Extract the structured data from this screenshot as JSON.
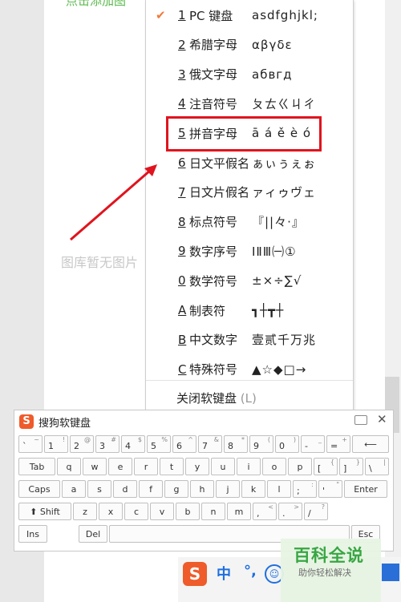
{
  "page": {
    "partial_top_text": "点击添加图",
    "no_image_text": "图库暂无图片"
  },
  "menu": {
    "items": [
      {
        "num": "1",
        "label": "PC 键盘",
        "sample": "asdfghjkl;",
        "checked": true
      },
      {
        "num": "2",
        "label": "希腊字母",
        "sample": "αβγδε",
        "checked": false
      },
      {
        "num": "3",
        "label": "俄文字母",
        "sample": "абвгд",
        "checked": false
      },
      {
        "num": "4",
        "label": "注音符号",
        "sample": "ㄆㄊㄍㄐㄔ",
        "checked": false
      },
      {
        "num": "5",
        "label": "拼音字母",
        "sample": "ā á ě è ó",
        "checked": false
      },
      {
        "num": "6",
        "label": "日文平假名",
        "sample": "ぁぃぅぇぉ",
        "checked": false
      },
      {
        "num": "7",
        "label": "日文片假名",
        "sample": "ァィゥヴェ",
        "checked": false
      },
      {
        "num": "8",
        "label": "标点符号",
        "sample": "『||々·』",
        "checked": false
      },
      {
        "num": "9",
        "label": "数字序号",
        "sample": "ⅠⅡⅢ㈠①",
        "checked": false
      },
      {
        "num": "0",
        "label": "数学符号",
        "sample": "±×÷∑√",
        "checked": false
      },
      {
        "num": "A",
        "label": "制表符",
        "sample": "┓┼┳┼",
        "checked": false
      },
      {
        "num": "B",
        "label": "中文数字",
        "sample": "壹贰千万兆",
        "checked": false
      },
      {
        "num": "C",
        "label": "特殊符号",
        "sample": "▲☆◆□→",
        "checked": false
      }
    ],
    "close_label": "关闭软键盘",
    "close_shortcut": "(L)",
    "check_mark": "✔",
    "highlight_color": "#e0141e",
    "arrow_color": "#e0141e"
  },
  "keyboard": {
    "title": "搜狗软键盘",
    "logo": "S",
    "close_glyph": "✕",
    "rows": [
      [
        {
          "up": "~",
          "dn": "`"
        },
        {
          "up": "!",
          "dn": "1"
        },
        {
          "up": "@",
          "dn": "2"
        },
        {
          "up": "#",
          "dn": "3"
        },
        {
          "up": "$",
          "dn": "4"
        },
        {
          "up": "%",
          "dn": "5"
        },
        {
          "up": "^",
          "dn": "6"
        },
        {
          "up": "&",
          "dn": "7"
        },
        {
          "up": "*",
          "dn": "8"
        },
        {
          "up": "(",
          "dn": "9"
        },
        {
          "up": ")",
          "dn": "0"
        },
        {
          "up": "_",
          "dn": "-"
        },
        {
          "up": "+",
          "dn": "="
        },
        {
          "mid": "⟵"
        }
      ],
      [
        {
          "mid": "Tab"
        },
        {
          "mid": "q"
        },
        {
          "mid": "w"
        },
        {
          "mid": "e"
        },
        {
          "mid": "r"
        },
        {
          "mid": "t"
        },
        {
          "mid": "y"
        },
        {
          "mid": "u"
        },
        {
          "mid": "i"
        },
        {
          "mid": "o"
        },
        {
          "mid": "p"
        },
        {
          "up": "{",
          "dn": "["
        },
        {
          "up": "}",
          "dn": "]"
        },
        {
          "up": "|",
          "dn": "\\"
        }
      ],
      [
        {
          "mid": "Caps"
        },
        {
          "mid": "a"
        },
        {
          "mid": "s"
        },
        {
          "mid": "d"
        },
        {
          "mid": "f"
        },
        {
          "mid": "g"
        },
        {
          "mid": "h"
        },
        {
          "mid": "j"
        },
        {
          "mid": "k"
        },
        {
          "mid": "l"
        },
        {
          "up": ":",
          "dn": ";"
        },
        {
          "up": "\"",
          "dn": "'"
        },
        {
          "mid": "Enter"
        }
      ],
      [
        {
          "mid": "⬆ Shift"
        },
        {
          "mid": "z"
        },
        {
          "mid": "x"
        },
        {
          "mid": "c"
        },
        {
          "mid": "v"
        },
        {
          "mid": "b"
        },
        {
          "mid": "n"
        },
        {
          "mid": "m"
        },
        {
          "up": "<",
          "dn": ","
        },
        {
          "up": ">",
          "dn": "."
        },
        {
          "up": "?",
          "dn": "/"
        }
      ],
      [
        {
          "mid": "Ins"
        },
        {
          "mid": "Del"
        },
        {
          "mid": ""
        },
        {
          "mid": "Esc"
        }
      ]
    ]
  },
  "taskbar": {
    "logo": "S",
    "mode": "中",
    "punc": "°,",
    "emoji": "☺"
  },
  "watermark": {
    "main": "百科全说",
    "sub": "助你轻松解决"
  }
}
